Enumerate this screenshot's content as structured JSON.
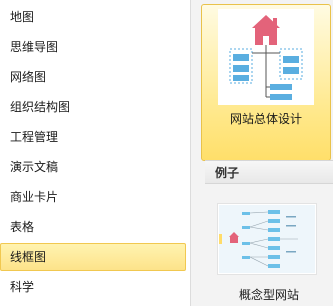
{
  "sidebar": {
    "items": [
      {
        "label": "地图"
      },
      {
        "label": "思维导图"
      },
      {
        "label": "网络图"
      },
      {
        "label": "组织结构图"
      },
      {
        "label": "工程管理"
      },
      {
        "label": "演示文稿"
      },
      {
        "label": "商业卡片"
      },
      {
        "label": "表格"
      },
      {
        "label": "线框图",
        "selected": true
      },
      {
        "label": "科学"
      }
    ]
  },
  "templates": {
    "selected_card": {
      "label": "网站总体设计"
    }
  },
  "examples": {
    "header": "例子",
    "items": [
      {
        "label": "概念型网站"
      }
    ]
  },
  "colors": {
    "selected_bg": "#fde38a",
    "house_icon": "#e3637a",
    "diagram_blue": "#5aaee0"
  }
}
